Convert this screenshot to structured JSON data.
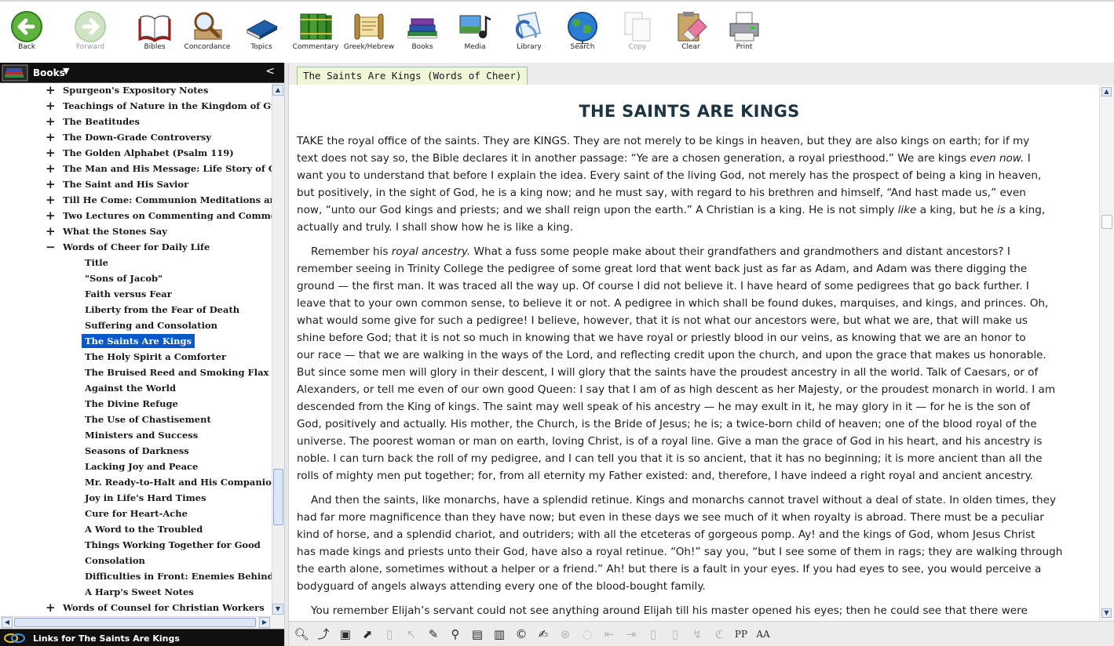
{
  "toolbar": {
    "items": [
      {
        "label": "Back",
        "icon": "back-arrow-icon",
        "enabled": true
      },
      {
        "label": "Forward",
        "icon": "forward-arrow-icon",
        "enabled": false
      },
      {
        "label": "Bibles",
        "icon": "open-bible-icon",
        "enabled": true
      },
      {
        "label": "Concordance",
        "icon": "magnifier-book-icon",
        "enabled": true
      },
      {
        "label": "Topics",
        "icon": "topics-book-icon",
        "enabled": true
      },
      {
        "label": "Commentary",
        "icon": "commentary-books-icon",
        "enabled": true
      },
      {
        "label": "Greek/Hebrew",
        "icon": "scroll-icon",
        "enabled": true
      },
      {
        "label": "Books",
        "icon": "book-stack-icon",
        "enabled": true
      },
      {
        "label": "Media",
        "icon": "media-icon",
        "enabled": true
      },
      {
        "label": "Library",
        "icon": "library-icon",
        "enabled": true
      },
      {
        "label": "Search",
        "icon": "globe-icon",
        "enabled": true
      },
      {
        "label": "Copy",
        "icon": "copy-icon",
        "enabled": false
      },
      {
        "label": "Clear",
        "icon": "eraser-clipboard-icon",
        "enabled": true
      },
      {
        "label": "Print",
        "icon": "printer-icon",
        "enabled": true
      }
    ]
  },
  "books_panel": {
    "title": "Books",
    "dropdown_glyph": "▼",
    "collapse_glyph": "<"
  },
  "tree": {
    "nodes": [
      {
        "label": "Spurgeon's Expository Notes",
        "level": 0,
        "expander": "+"
      },
      {
        "label": "Teachings of Nature in the Kingdom of Grace",
        "level": 0,
        "expander": "+"
      },
      {
        "label": "The Beatitudes",
        "level": 0,
        "expander": "+"
      },
      {
        "label": "The Down-Grade Controversy",
        "level": 0,
        "expander": "+"
      },
      {
        "label": "The Golden Alphabet (Psalm 119)",
        "level": 0,
        "expander": "+"
      },
      {
        "label": "The Man and His Message: Life Story of Charles",
        "level": 0,
        "expander": "+"
      },
      {
        "label": "The Saint and His Savior",
        "level": 0,
        "expander": "+"
      },
      {
        "label": "Till He Come: Communion Meditations and Addr",
        "level": 0,
        "expander": "+"
      },
      {
        "label": "Two Lectures on Commenting and Commentarie",
        "level": 0,
        "expander": "+"
      },
      {
        "label": "What the Stones Say",
        "level": 0,
        "expander": "+"
      },
      {
        "label": "Words of Cheer for Daily Life",
        "level": 0,
        "expander": "−"
      },
      {
        "label": "Title",
        "level": 1,
        "expander": ""
      },
      {
        "label": "\"Sons of Jacob\"",
        "level": 1,
        "expander": ""
      },
      {
        "label": "Faith versus Fear",
        "level": 1,
        "expander": ""
      },
      {
        "label": "Liberty from the Fear of Death",
        "level": 1,
        "expander": ""
      },
      {
        "label": "Suffering and Consolation",
        "level": 1,
        "expander": ""
      },
      {
        "label": "The Saints Are Kings",
        "level": 1,
        "expander": "",
        "selected": true
      },
      {
        "label": "The Holy Spirit a Comforter",
        "level": 1,
        "expander": ""
      },
      {
        "label": "The Bruised Reed and Smoking Flax",
        "level": 1,
        "expander": ""
      },
      {
        "label": "Against the World",
        "level": 1,
        "expander": ""
      },
      {
        "label": "The Divine Refuge",
        "level": 1,
        "expander": ""
      },
      {
        "label": "The Use of Chastisement",
        "level": 1,
        "expander": ""
      },
      {
        "label": "Ministers and Success",
        "level": 1,
        "expander": ""
      },
      {
        "label": "Seasons of Darkness",
        "level": 1,
        "expander": ""
      },
      {
        "label": "Lacking Joy and Peace",
        "level": 1,
        "expander": ""
      },
      {
        "label": "Mr. Ready-to-Halt and His Companions",
        "level": 1,
        "expander": ""
      },
      {
        "label": "Joy in Life's Hard Times",
        "level": 1,
        "expander": ""
      },
      {
        "label": "Cure for Heart-Ache",
        "level": 1,
        "expander": ""
      },
      {
        "label": "A Word to the Troubled",
        "level": 1,
        "expander": ""
      },
      {
        "label": "Things Working Together for Good",
        "level": 1,
        "expander": ""
      },
      {
        "label": "Consolation",
        "level": 1,
        "expander": ""
      },
      {
        "label": "Difficulties in Front: Enemies Behind",
        "level": 1,
        "expander": ""
      },
      {
        "label": "A Harp's Sweet Notes",
        "level": 1,
        "expander": ""
      },
      {
        "label": "Words of Counsel for Christian Workers",
        "level": 0,
        "expander": "+"
      }
    ]
  },
  "links_bar": {
    "text": "Links for The Saints Are Kings"
  },
  "document": {
    "tab_label": "The Saints Are Kings (Words of Cheer)",
    "heading": "THE SAINTS ARE KINGS",
    "paragraphs": [
      {
        "indent": false,
        "lines": [
          [
            {
              "t": "TAKE the royal office of the saints. They are KINGS. They are not merely to be kings in heaven, but they are also kings on earth; for if my"
            }
          ],
          [
            {
              "t": "text does not say so, the Bible declares it in another passage: “Ye are a chosen generation, a royal priesthood.” We are kings "
            },
            {
              "t": "even now.",
              "i": true
            },
            {
              "t": " I"
            }
          ],
          [
            {
              "t": "want you to understand that before I explain the idea. Every saint of the living God, not merely has the prospect of being a king in heaven,"
            }
          ],
          [
            {
              "t": "but positively, in the sight of God, he is a king now; and he must say, with regard to his brethren and himself, “And hast made us,” even"
            }
          ],
          [
            {
              "t": "now, “unto our God kings and priests; and we shall reign upon the earth.” A Christian is a king. He is not simply "
            },
            {
              "t": "like",
              "i": true
            },
            {
              "t": " a king, but he "
            },
            {
              "t": "is",
              "i": true
            },
            {
              "t": " a king,"
            }
          ],
          [
            {
              "t": "actually and truly. I shall show how he is like a king."
            }
          ]
        ]
      },
      {
        "indent": true,
        "lines": [
          [
            {
              "t": "Remember his "
            },
            {
              "t": "royal ancestry.",
              "i": true
            },
            {
              "t": " What a fuss some people make about their grandfathers and grandmothers and distant ancestors? I"
            }
          ],
          [
            {
              "t": "remember seeing in Trinity College the pedigree of some great lord that went back just as far as Adam, and Adam was there digging the"
            }
          ],
          [
            {
              "t": "ground — the first man. It was traced all the way up. Of course I did not believe it. I have heard of some pedigrees that go back further. I"
            }
          ],
          [
            {
              "t": "leave that to your own common sense, to believe it or not. A pedigree in which shall be found dukes, marquises, and kings, and princes. Oh,"
            }
          ],
          [
            {
              "t": "what would some give for such a pedigree! I believe, however, that it is not what our ancestors were, but what we are, that will make us"
            }
          ],
          [
            {
              "t": "shine before God; that it is not so much in knowing that we have royal or priestly blood in our veins, as knowing that we are an honor to"
            }
          ],
          [
            {
              "t": "our race — that we are walking in the ways of the Lord, and reflecting credit upon the church, and upon the grace that makes us honorable."
            }
          ],
          [
            {
              "t": "But since some men will glory in their descent, I will glory that the saints have the proudest ancestry in all the world. Talk of Caesars, or of"
            }
          ],
          [
            {
              "t": "Alexanders, or tell me even of our own good Queen: I say that I am of as high descent as her Majesty, or the proudest monarch in world. I am"
            }
          ],
          [
            {
              "t": "descended from the King of kings. The saint may well speak of his ancestry — he may exult in it, he may glory in it — for he is the son of"
            }
          ],
          [
            {
              "t": "God, positively and actually. His mother, the Church, is the Bride of Jesus; he is; a twice-born child of heaven; one of the blood royal of the"
            }
          ],
          [
            {
              "t": "universe. The poorest woman or man on earth, loving Christ, is of a royal line. Give a man the grace of God in his heart, and his ancestry is"
            }
          ],
          [
            {
              "t": "noble. I can turn back the roll of my pedigree, and I can tell you that it is so ancient, that it has no beginning; it is more ancient than all the"
            }
          ],
          [
            {
              "t": "rolls of mighty men put together; for, from all eternity my Father existed: and, therefore, I have indeed a right royal and ancient ancestry."
            }
          ]
        ]
      },
      {
        "indent": true,
        "lines": [
          [
            {
              "t": "And then the saints, like monarchs, have a splendid retinue. Kings and monarchs cannot travel without a deal of state. In olden times, they"
            }
          ],
          [
            {
              "t": "had far more magnificence than they have now; but even in these days we see much of it when royalty is abroad. There must be a peculiar"
            }
          ],
          [
            {
              "t": "kind of horse, and a splendid chariot, and outriders; with all the etceteras of gorgeous pomp. Ay! and the kings of God, whom Jesus Christ"
            }
          ],
          [
            {
              "t": "has made kings and priests unto their God, have also a royal retinue. “Oh!” say you, “but I see some of them in rags; they are walking through"
            }
          ],
          [
            {
              "t": "the earth alone, sometimes without a helper or a friend.” Ah! but there is a fault in your eyes. If you had eyes to see, you would perceive a"
            }
          ],
          [
            {
              "t": "bodyguard of angels always attending every one of the blood-bought family."
            }
          ]
        ]
      },
      {
        "indent": true,
        "lines": [
          [
            {
              "t": "You remember Elijah’s servant could not see anything around Elijah till his master opened his eyes; then he could see that there were"
            }
          ]
        ]
      }
    ]
  },
  "bottom_tools": {
    "items": [
      {
        "glyph": "🔍︎",
        "icon": "find-icon",
        "enabled": true
      },
      {
        "glyph": "⤴",
        "icon": "find-next-icon",
        "enabled": true
      },
      {
        "glyph": "▣",
        "icon": "find-in-page-icon",
        "enabled": true
      },
      {
        "glyph": "⬈",
        "icon": "goto-link-icon",
        "enabled": true
      },
      {
        "glyph": "▯",
        "icon": "bookmark-icon",
        "enabled": false
      },
      {
        "glyph": "↖",
        "icon": "pointer-icon",
        "enabled": false
      },
      {
        "glyph": "✎",
        "icon": "annotate-icon",
        "enabled": true
      },
      {
        "glyph": "⚲",
        "icon": "people-icon",
        "enabled": true
      },
      {
        "glyph": "▤",
        "icon": "page-icon",
        "enabled": true
      },
      {
        "glyph": "▥",
        "icon": "page-list-icon",
        "enabled": true
      },
      {
        "glyph": "©",
        "icon": "copyright-icon",
        "enabled": true
      },
      {
        "glyph": "✍",
        "icon": "notes-icon",
        "enabled": true
      },
      {
        "glyph": "⊗",
        "icon": "cancel-icon",
        "enabled": false
      },
      {
        "glyph": "◌",
        "icon": "loop-icon",
        "enabled": false
      },
      {
        "glyph": "⇤",
        "icon": "first-icon",
        "enabled": false
      },
      {
        "glyph": "⇥",
        "icon": "last-icon",
        "enabled": false
      },
      {
        "glyph": "▯",
        "icon": "doc-icon",
        "enabled": false
      },
      {
        "glyph": "▯",
        "icon": "doc2-icon",
        "enabled": false
      },
      {
        "glyph": "↯",
        "icon": "jump-icon",
        "enabled": false
      },
      {
        "glyph": "ℭ",
        "icon": "compare-icon",
        "enabled": false
      },
      {
        "glyph": "PP",
        "icon": "paragraph-icon",
        "enabled": true
      },
      {
        "glyph": "AA",
        "icon": "font-size-icon",
        "enabled": true
      }
    ]
  }
}
